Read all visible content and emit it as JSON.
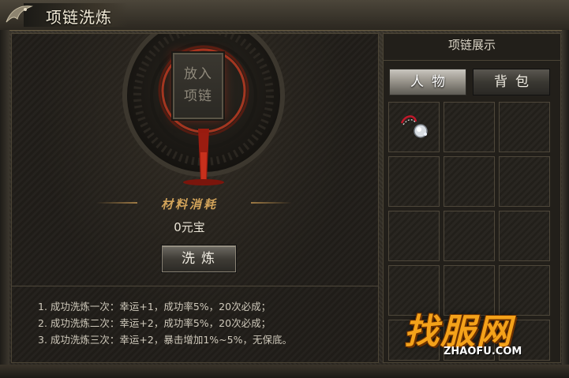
{
  "window": {
    "title": "项链洗炼"
  },
  "refine": {
    "slot_line1": "放入",
    "slot_line2": "项链",
    "material_label": "材料消耗",
    "cost": "0元宝",
    "button_label": "洗炼"
  },
  "rules": [
    "1. 成功洗炼一次：幸运+1，成功率5%，20次必成；",
    "2. 成功洗炼二次：幸运+2，成功率5%，20次必成；",
    "3. 成功洗炼三次：幸运+2，暴击增加1%~5%，无保底。"
  ],
  "display": {
    "title": "项链展示",
    "tabs": [
      {
        "label": "人物",
        "active": true
      },
      {
        "label": "背包",
        "active": false
      }
    ],
    "slots": [
      {
        "item": "necklace-icon"
      },
      {
        "item": ""
      },
      {
        "item": ""
      },
      {
        "item": ""
      },
      {
        "item": ""
      },
      {
        "item": ""
      },
      {
        "item": ""
      },
      {
        "item": ""
      },
      {
        "item": ""
      },
      {
        "item": ""
      },
      {
        "item": ""
      },
      {
        "item": ""
      },
      {
        "item": ""
      },
      {
        "item": ""
      },
      {
        "item": ""
      }
    ]
  },
  "watermark": {
    "main": "找服网",
    "sub": "ZHAOFU.COM"
  },
  "colors": {
    "accent_gold": "#d3a45a",
    "glow_red": "#b4281a",
    "watermark_orange": "#f4a21a"
  }
}
